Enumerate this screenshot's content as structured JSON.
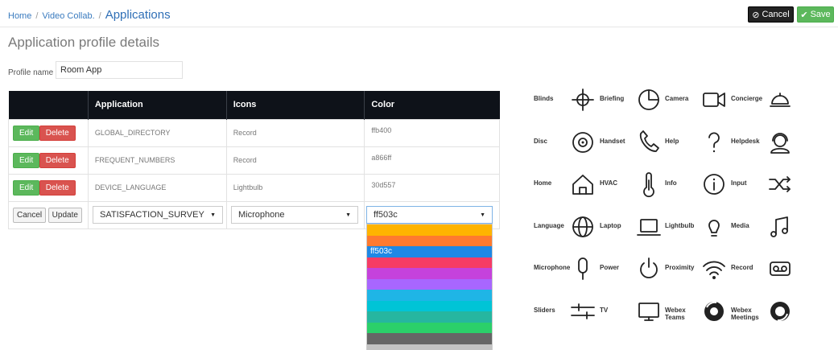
{
  "breadcrumb": {
    "home": "Home",
    "sep1": "/",
    "video": "Video Collab.",
    "sep2": "/",
    "current": "Applications"
  },
  "toolbar": {
    "cancel_label": "Cancel",
    "save_label": "Save"
  },
  "page": {
    "title": "Application profile details",
    "profile_label": "Profile name",
    "profile_value": "Room App"
  },
  "table": {
    "headers": [
      "",
      "Application",
      "Icons",
      "Color"
    ],
    "edit_label": "Edit",
    "delete_label": "Delete",
    "rows": [
      {
        "application": "GLOBAL_DIRECTORY",
        "icon": "Record",
        "color": "ffb400"
      },
      {
        "application": "FREQUENT_NUMBERS",
        "icon": "Record",
        "color": "a866ff"
      },
      {
        "application": "DEVICE_LANGUAGE",
        "icon": "Lightbulb",
        "color": "30d557"
      }
    ],
    "edit_row": {
      "cancel_label": "Cancel",
      "update_label": "Update",
      "application": "SATISFACTION_SURVEY",
      "icon": "Microphone",
      "color": "ff503c"
    }
  },
  "color_dropdown": {
    "selected_label": "ff503c",
    "options": [
      "#ffb400",
      "#ff7a2f",
      "#1e88e5",
      "#f63c65",
      "#c542dc",
      "#a866ff",
      "#1fb5e6",
      "#00c4d6",
      "#26b6a0",
      "#2bd06a",
      "#666666",
      "#c3c3c3"
    ],
    "selected_index": 2
  },
  "icons": [
    {
      "label": "Blinds",
      "icon": "blinds-icon"
    },
    {
      "label": "Briefing",
      "icon": "briefing-icon"
    },
    {
      "label": "Camera",
      "icon": "camera-icon"
    },
    {
      "label": "Concierge",
      "icon": "concierge-icon"
    },
    {
      "label": "Disc",
      "icon": "disc-icon"
    },
    {
      "label": "Handset",
      "icon": "handset-icon"
    },
    {
      "label": "Help",
      "icon": "help-icon"
    },
    {
      "label": "Helpdesk",
      "icon": "helpdesk-icon"
    },
    {
      "label": "Home",
      "icon": "home-icon"
    },
    {
      "label": "HVAC",
      "icon": "hvac-icon"
    },
    {
      "label": "Info",
      "icon": "info-icon"
    },
    {
      "label": "Input",
      "icon": "input-icon"
    },
    {
      "label": "Language",
      "icon": "language-icon"
    },
    {
      "label": "Laptop",
      "icon": "laptop-icon"
    },
    {
      "label": "Lightbulb",
      "icon": "lightbulb-icon"
    },
    {
      "label": "Media",
      "icon": "media-icon"
    },
    {
      "label": "Microphone",
      "icon": "microphone-icon"
    },
    {
      "label": "Power",
      "icon": "power-icon"
    },
    {
      "label": "Proximity",
      "icon": "proximity-icon"
    },
    {
      "label": "Record",
      "icon": "record-icon"
    },
    {
      "label": "Sliders",
      "icon": "sliders-icon"
    },
    {
      "label": "TV",
      "icon": "tv-icon"
    },
    {
      "label": "Webex Teams",
      "icon": "webex-teams-icon"
    },
    {
      "label": "Webex Meetings",
      "icon": "webex-meetings-icon"
    }
  ]
}
